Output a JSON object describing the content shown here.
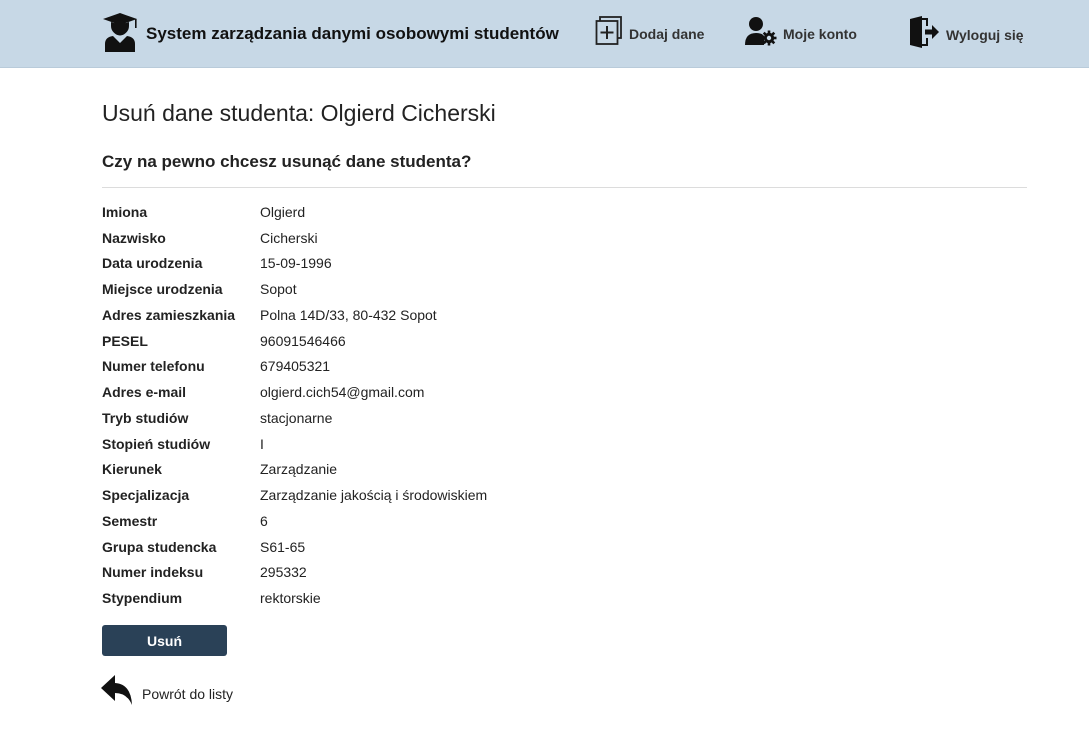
{
  "header": {
    "brand_icon": "student-graduate-icon",
    "title": "System zarządzania danymi osobowymi studentów",
    "nav": {
      "add": {
        "label": "Dodaj dane",
        "icon": "add-document-icon"
      },
      "account": {
        "label": "Moje konto",
        "icon": "user-gear-icon"
      },
      "logout": {
        "label": "Wyloguj się",
        "icon": "logout-door-icon"
      }
    }
  },
  "page": {
    "title": "Usuń dane studenta: Olgierd Cicherski",
    "confirm_question": "Czy na pewno chcesz usunąć dane studenta?"
  },
  "details": [
    {
      "label": "Imiona",
      "value": "Olgierd"
    },
    {
      "label": "Nazwisko",
      "value": "Cicherski"
    },
    {
      "label": "Data urodzenia",
      "value": "15-09-1996"
    },
    {
      "label": "Miejsce urodzenia",
      "value": "Sopot"
    },
    {
      "label": "Adres zamieszkania",
      "value": "Polna 14D/33, 80-432 Sopot"
    },
    {
      "label": "PESEL",
      "value": "96091546466"
    },
    {
      "label": "Numer telefonu",
      "value": "679405321"
    },
    {
      "label": "Adres e-mail",
      "value": "olgierd.cich54@gmail.com"
    },
    {
      "label": "Tryb studiów",
      "value": "stacjonarne"
    },
    {
      "label": "Stopień studiów",
      "value": "I"
    },
    {
      "label": "Kierunek",
      "value": "Zarządzanie"
    },
    {
      "label": "Specjalizacja",
      "value": "Zarządzanie jakością i środowiskiem"
    },
    {
      "label": "Semestr",
      "value": "6"
    },
    {
      "label": "Grupa studencka",
      "value": "S61-65"
    },
    {
      "label": "Numer indeksu",
      "value": "295332"
    },
    {
      "label": "Stypendium",
      "value": "rektorskie"
    }
  ],
  "actions": {
    "delete_label": "Usuń",
    "back_label": "Powrót do listy",
    "back_icon": "reply-arrow-icon"
  },
  "colors": {
    "navbar_bg": "#c7d8e6",
    "button_bg": "#2a4157"
  }
}
